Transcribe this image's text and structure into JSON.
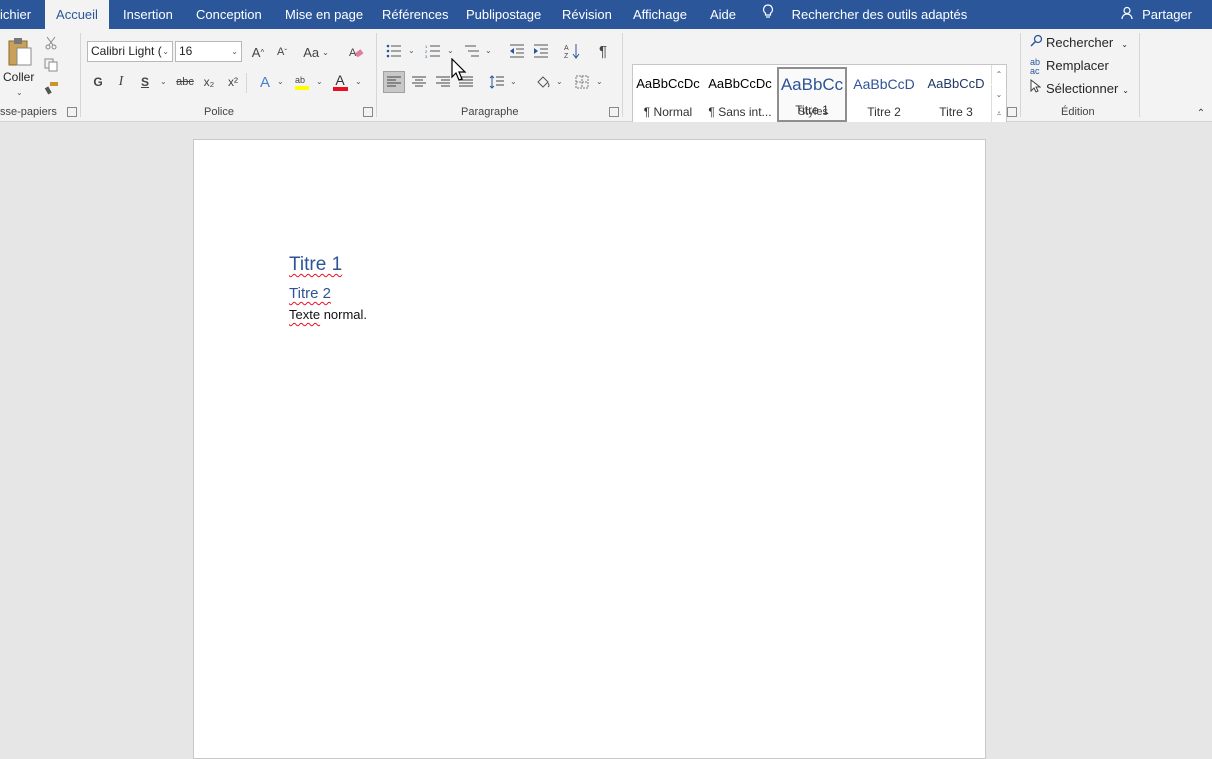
{
  "tabs": [
    {
      "label": "ichier"
    },
    {
      "label": "Accueil",
      "active": true
    },
    {
      "label": "Insertion"
    },
    {
      "label": "Conception"
    },
    {
      "label": "Mise en page"
    },
    {
      "label": "Références"
    },
    {
      "label": "Publipostage"
    },
    {
      "label": "Révision"
    },
    {
      "label": "Affichage"
    },
    {
      "label": "Aide"
    }
  ],
  "tell_me": "Rechercher des outils adaptés",
  "share": "Partager",
  "clipboard": {
    "paste": "Coller",
    "label": "sse-papiers"
  },
  "font": {
    "name": "Calibri Light (",
    "size": "16",
    "label": "Police",
    "bold": "G",
    "italic": "I",
    "underline": "S",
    "strike": "abc",
    "sub": "x₂",
    "sup": "x²",
    "case": "Aa",
    "grow": "A",
    "shrink": "A",
    "font_color": "A",
    "effects": "A"
  },
  "paragraph": {
    "label": "Paragraphe",
    "pilcrow": "¶"
  },
  "styles": {
    "label": "Styles",
    "items": [
      {
        "preview": "AaBbCcDc",
        "name": "¶ Normal"
      },
      {
        "preview": "AaBbCcDc",
        "name": "¶ Sans int..."
      },
      {
        "preview": "AaBbCc",
        "name": "Titre 1",
        "selected": true
      },
      {
        "preview": "AaBbCcD",
        "name": "Titre 2"
      },
      {
        "preview": "AaBbCcD",
        "name": "Titre 3"
      }
    ]
  },
  "editing": {
    "label": "Édition",
    "find": "Rechercher",
    "replace": "Remplacer",
    "select": "Sélectionner"
  },
  "document": {
    "title1": "Titre 1",
    "title2": "Titre 2",
    "body_word1": "Texte",
    "body_rest": " normal."
  },
  "colors": {
    "accent": "#2b579a",
    "heading": "#2f5496",
    "highlight": "#ffff00",
    "font_color": "#e81123"
  }
}
